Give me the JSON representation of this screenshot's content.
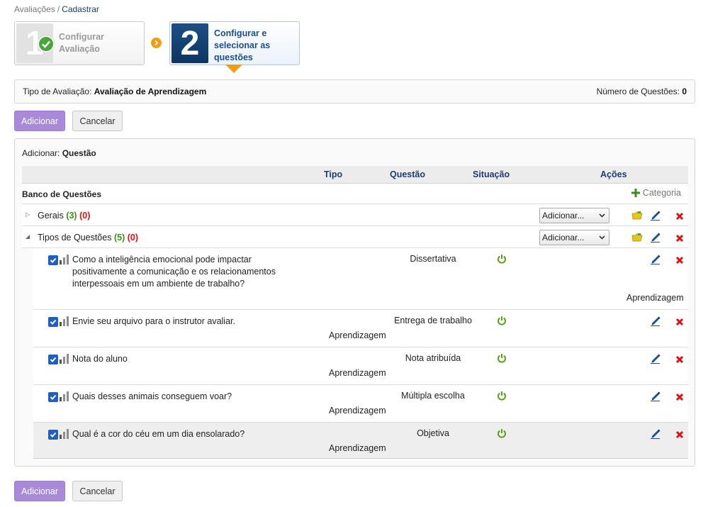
{
  "breadcrumb": {
    "root": "Avaliações",
    "separator": "/",
    "current": "Cadastrar"
  },
  "steps": [
    {
      "number": "1",
      "label": "Configurar Avaliação",
      "status": "done"
    },
    {
      "number": "2",
      "label": "Configurar e selecionar as questões",
      "status": "active"
    }
  ],
  "info": {
    "type_label": "Tipo de Avaliação:",
    "type_value": "Avaliação de Aprendizagem",
    "count_label": "Número de Questões:",
    "count_value": "0"
  },
  "actions": {
    "add_label": "Adicionar",
    "cancel_label": "Cancelar"
  },
  "panel": {
    "add_label": "Adicionar:",
    "add_value": "Questão",
    "columns": {
      "tipo": "Tipo",
      "questao": "Questão",
      "situacao": "Situação",
      "acoes": "Ações"
    },
    "bank_title": "Banco de Questões",
    "add_category_label": "Categoria",
    "groups": [
      {
        "name": "Gerais",
        "count_ok": "(3)",
        "count_err": "(0)",
        "select_label": "Adicionar...",
        "expanded": false
      },
      {
        "name": "Tipos de Questões",
        "count_ok": "(5)",
        "count_err": "(0)",
        "select_label": "Adicionar...",
        "expanded": true
      }
    ],
    "questions": [
      {
        "text_lines": [
          "Como a inteligência emocional pode impactar",
          "positivamente a comunicação e os relacionamentos",
          "interpessoais em um ambiente de trabalho?"
        ],
        "type": "Dissertativa",
        "category": "Aprendizagem"
      },
      {
        "text_lines": [
          "Envie seu arquivo para o instrutor avaliar."
        ],
        "type": "Entrega de trabalho",
        "category": "Aprendizagem"
      },
      {
        "text_lines": [
          "Nota do aluno"
        ],
        "type": "Nota atribuída",
        "category": "Aprendizagem"
      },
      {
        "text_lines": [
          "Quais desses animais conseguem voar?"
        ],
        "type": "Múltipla escolha",
        "category": "Aprendizagem"
      },
      {
        "text_lines": [
          "Qual é a cor do céu em um dia ensolarado?"
        ],
        "type": "Objetiva",
        "category": "Aprendizagem"
      }
    ]
  },
  "colors": {
    "primary_button": "#a98ad8",
    "header_text": "#1f3b6b",
    "ok_green": "#3a8f1e",
    "error_red": "#d11111",
    "step_orange": "#f29c12",
    "checkbox_blue": "#1e5fbf"
  },
  "icons": [
    "check-circle-icon",
    "chevron-right-icon",
    "plus-icon",
    "triangle-right-icon",
    "triangle-down-icon",
    "folder-icon",
    "pencil-icon",
    "delete-icon",
    "power-icon",
    "checkbox-icon",
    "difficulty-bars-icon"
  ]
}
